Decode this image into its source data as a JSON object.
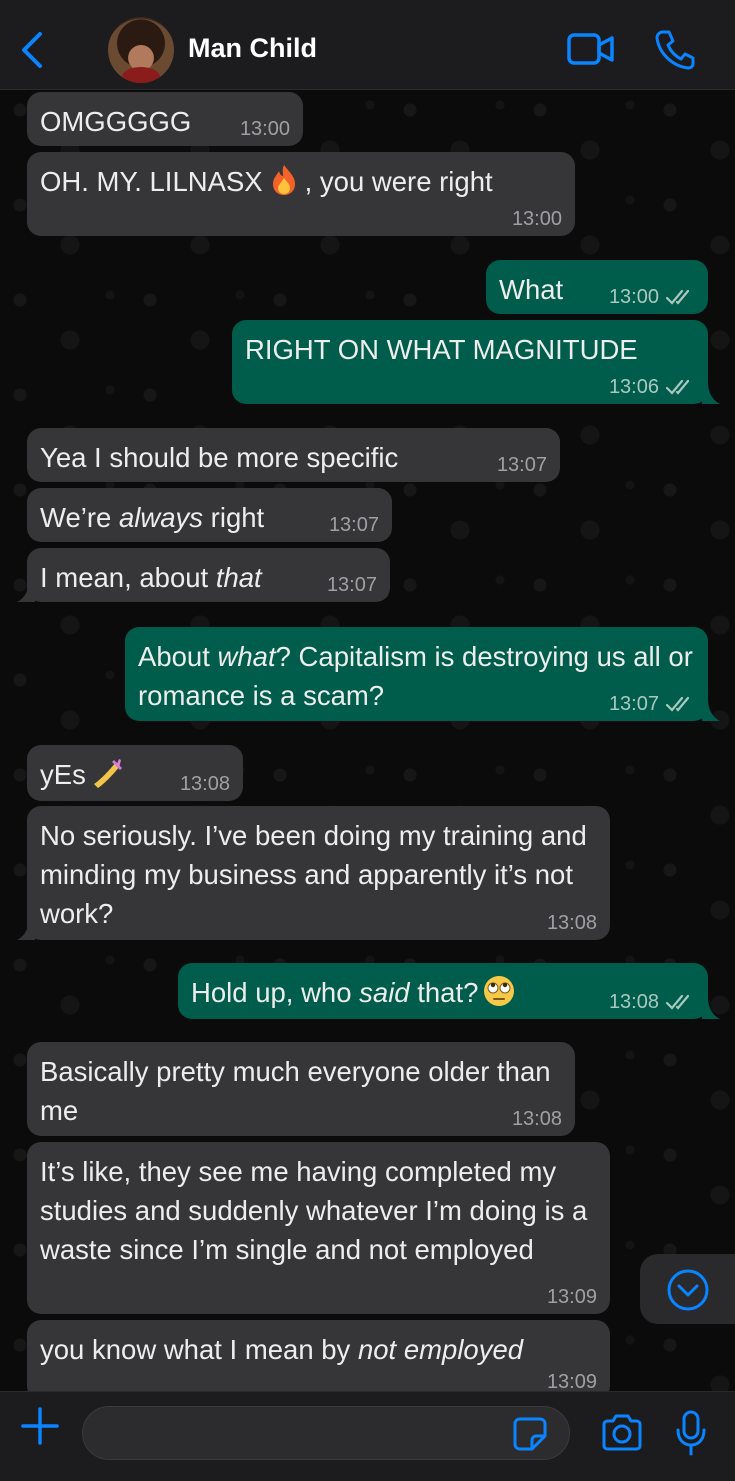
{
  "header": {
    "back_label": "back",
    "contact_name": "Man Child",
    "video_call": "video-call",
    "voice_call": "voice-call"
  },
  "messages": [
    {
      "dir": "in",
      "text": "OMGGGGG",
      "time": "13:00"
    },
    {
      "dir": "in",
      "text": "OH. MY. LILNASX 🔥, you were right",
      "time": "13:00"
    },
    {
      "dir": "out",
      "text": "What",
      "time": "13:00",
      "status": "read"
    },
    {
      "dir": "out",
      "text": "RIGHT ON WHAT MAGNITUDE",
      "time": "13:06",
      "status": "read"
    },
    {
      "dir": "in",
      "text": "Yea I should be more specific",
      "time": "13:07"
    },
    {
      "dir": "in",
      "text": "We’re always right",
      "time": "13:07"
    },
    {
      "dir": "in",
      "text": "I mean, about that",
      "time": "13:07"
    },
    {
      "dir": "out",
      "text": "About what? Capitalism is destroying us all or romance is a scam?",
      "time": "13:07",
      "status": "read"
    },
    {
      "dir": "in",
      "text": "yEs 💅",
      "time": "13:08"
    },
    {
      "dir": "in",
      "text": "No seriously. I’ve been doing my training and minding my business and apparently it’s not work?",
      "time": "13:08"
    },
    {
      "dir": "out",
      "text": "Hold up, who said that? 🙄",
      "time": "13:08",
      "status": "read"
    },
    {
      "dir": "in",
      "text": "Basically pretty much everyone older than me",
      "time": "13:08"
    },
    {
      "dir": "in",
      "text": "It’s like, they see me having completed my studies and suddenly whatever I’m doing is a waste since I’m single and not employed",
      "time": "13:09"
    },
    {
      "dir": "in",
      "text": "you know what I mean by not employed",
      "time": "13:09"
    }
  ],
  "parts": {
    "m1a": "OH. MY. LILNASX",
    "m1b": ", you were right",
    "m5a": "We’re ",
    "m5b": "always",
    "m5c": " right",
    "m6a": "I mean, about ",
    "m6b": "that",
    "m7a": "About ",
    "m7b": "what",
    "m7c": "? Capitalism is destroying us all or romance is a scam?",
    "m8a": "yEs",
    "m10a": "Hold up, who ",
    "m10b": "said",
    "m10c": " that?",
    "m13a": "you know what I mean by ",
    "m13b": "not employed"
  },
  "composer": {
    "placeholder": "",
    "value": ""
  },
  "icons": {
    "back": "chevron-left-icon",
    "video": "video-camera-icon",
    "call": "phone-icon",
    "scroll": "chevron-down-circle-icon",
    "plus": "plus-icon",
    "sticker": "sticker-icon",
    "camera": "camera-icon",
    "mic": "microphone-icon",
    "read": "double-check-icon"
  },
  "colors": {
    "accent": "#0a84ff",
    "incoming_bubble": "#363638",
    "outgoing_bubble": "#005c4b"
  }
}
